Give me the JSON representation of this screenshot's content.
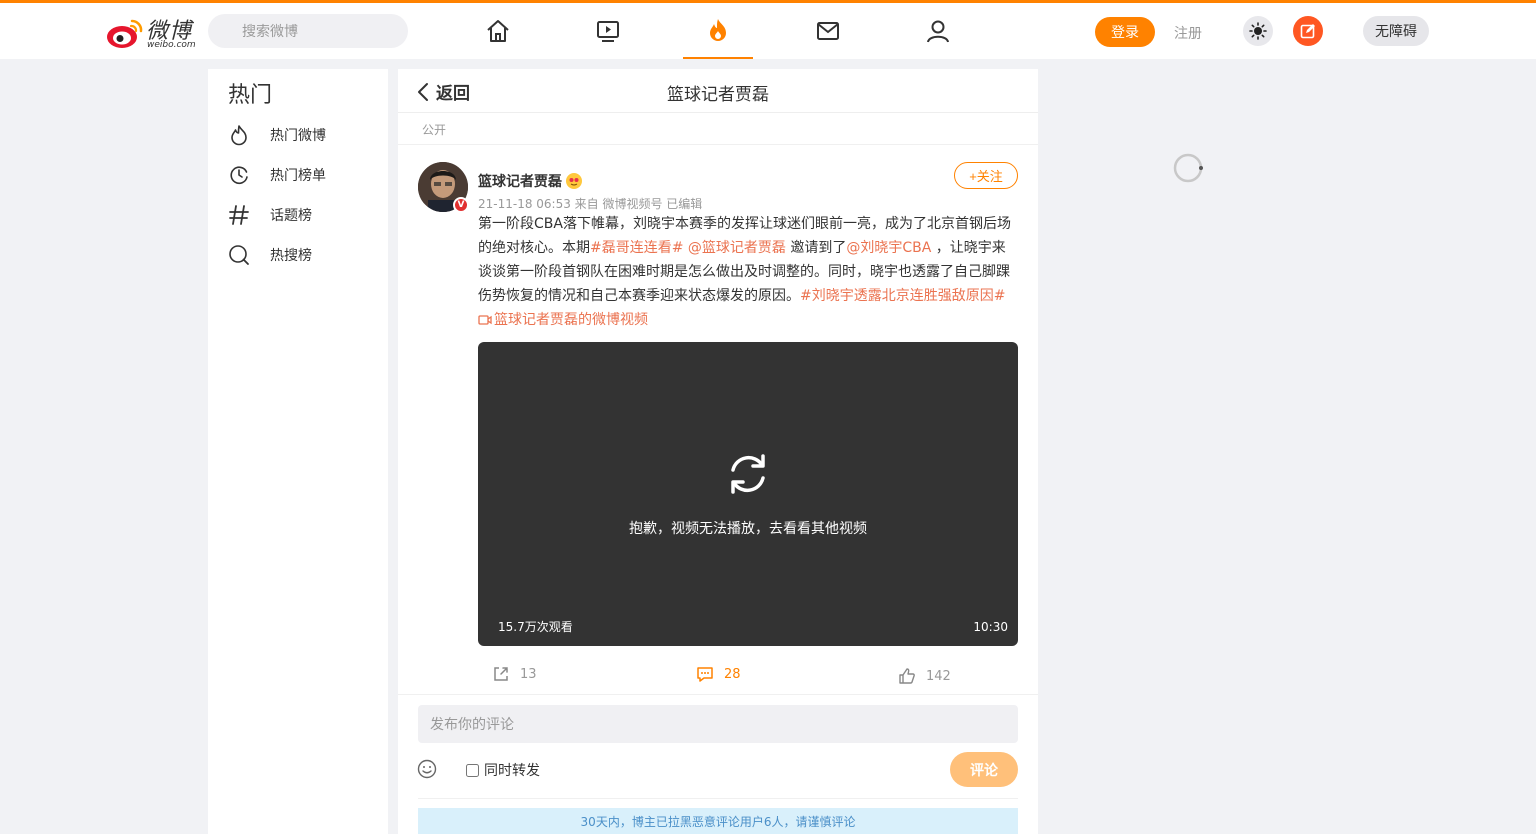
{
  "header": {
    "logo_text": "微博",
    "logo_sub": "weibo.com",
    "search_placeholder": "搜索微博",
    "nav": [
      "home-icon",
      "video-icon",
      "hot-icon",
      "mail-icon",
      "profile-icon"
    ],
    "login_label": "登录",
    "register_label": "注册",
    "accessibility_label": "无障碍",
    "accent_color": "#ff8200"
  },
  "sidebar": {
    "title": "热门",
    "items": [
      {
        "label": "热门微博",
        "icon": "flame-icon"
      },
      {
        "label": "热门榜单",
        "icon": "clock-icon"
      },
      {
        "label": "话题榜",
        "icon": "hashtag-icon"
      },
      {
        "label": "热搜榜",
        "icon": "search-icon"
      }
    ]
  },
  "main": {
    "back_label": "返回",
    "title": "篮球记者贾磊",
    "visibility": "公开",
    "post": {
      "author": "篮球记者贾磊",
      "badge": "V",
      "meta": "21-11-18 06:53 来自 微博视频号 已编辑",
      "follow_label": "+关注",
      "text_1": "第一阶段CBA落下帷幕，刘晓宇本赛季的发挥让球迷们眼前一亮，成为了北京首钢后场的绝对核心。本期",
      "tag_1": "#磊哥连连看#",
      "mention_1": "@篮球记者贾磊",
      "text_2": " 邀请到了",
      "mention_2": "@刘晓宇CBA",
      "text_3": " ，让晓宇来谈谈第一阶段首钢队在困难时期是怎么做出及时调整的。同时，晓宇也透露了自己脚踝伤势恢复的情况和自己本赛季迎来状态爆发的原因。",
      "tag_2": "#刘晓宇透露北京连胜强敌原因#",
      "video_link": "篮球记者贾磊的微博视频",
      "video": {
        "message": "抱歉，视频无法播放，去看看其他视频",
        "views": "15.7万次观看",
        "duration": "10:30"
      },
      "reposts": "13",
      "comments": "28",
      "likes": "142"
    },
    "comment_box": {
      "placeholder": "发布你的评论",
      "repost_label": "同时转发",
      "submit_label": "评论"
    },
    "notice": "30天内，博主已拉黑恶意评论用户6人，请谨慎评论"
  }
}
